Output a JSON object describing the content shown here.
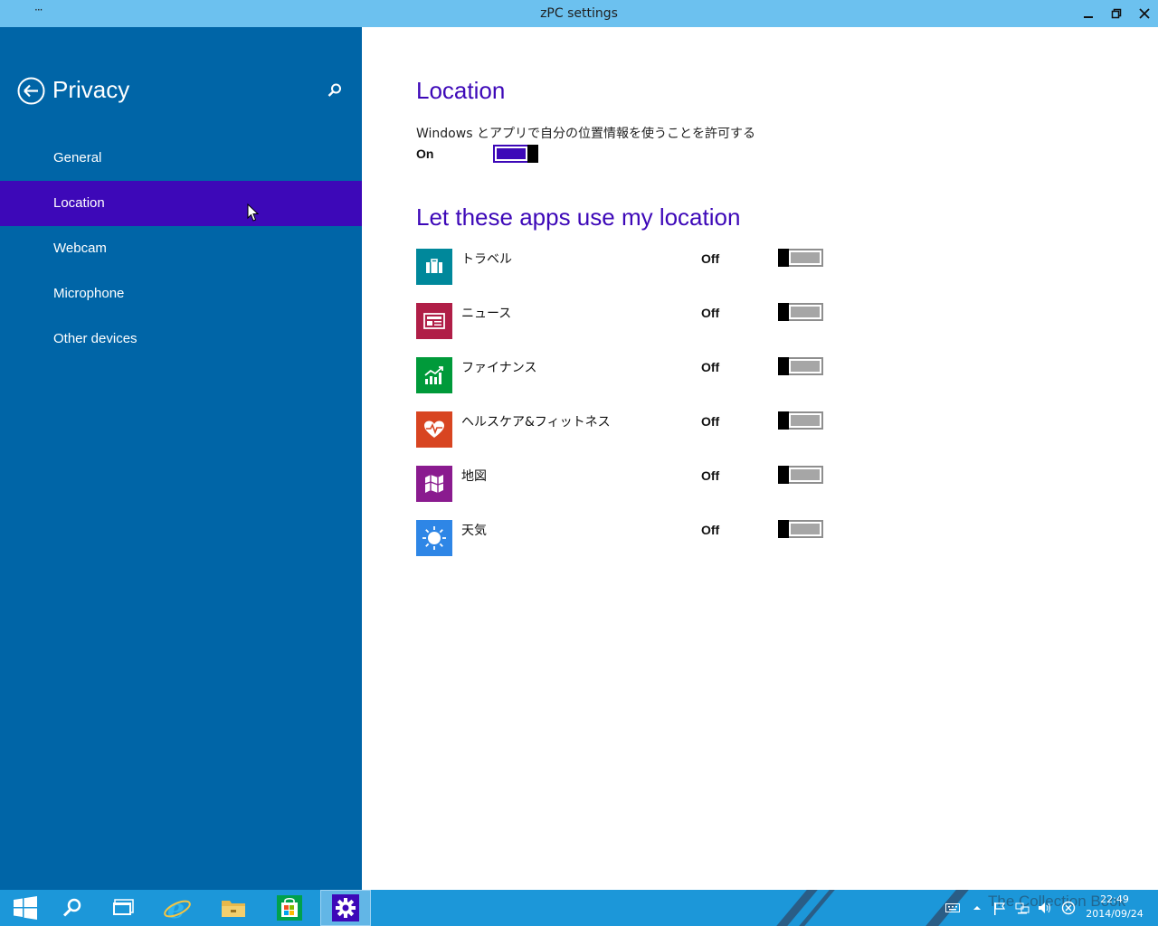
{
  "window": {
    "menu_glyph": "···",
    "title": "zPC settings"
  },
  "sidebar": {
    "title": "Privacy",
    "items": [
      {
        "label": "General",
        "active": false
      },
      {
        "label": "Location",
        "active": true
      },
      {
        "label": "Webcam",
        "active": false
      },
      {
        "label": "Microphone",
        "active": false
      },
      {
        "label": "Other devices",
        "active": false
      }
    ]
  },
  "main": {
    "heading": "Location",
    "description": "Windows とアプリで自分の位置情報を使うことを許可する",
    "location_state": "On",
    "apps_heading": "Let these apps use my location",
    "apps": [
      {
        "name": "トラベル",
        "state": "Off",
        "icon": "briefcase-icon",
        "color": "#00889b"
      },
      {
        "name": "ニュース",
        "state": "Off",
        "icon": "newspaper-icon",
        "color": "#b01e47"
      },
      {
        "name": "ファイナンス",
        "state": "Off",
        "icon": "chart-icon",
        "color": "#009a3a"
      },
      {
        "name": "ヘルスケア&フィットネス",
        "state": "Off",
        "icon": "heartbeat-icon",
        "color": "#d84521"
      },
      {
        "name": "地図",
        "state": "Off",
        "icon": "map-icon",
        "color": "#8a1b8f"
      },
      {
        "name": "天気",
        "state": "Off",
        "icon": "sun-icon",
        "color": "#2e86e6"
      }
    ]
  },
  "taskbar": {
    "watermark": "The Collection Book",
    "time": "22:49",
    "date": "2014/09/24"
  },
  "colors": {
    "accent": "#3d08b8",
    "sidebar": "#0065a7",
    "titlebar": "#6cc1ef",
    "taskbar": "#1c97d9"
  }
}
